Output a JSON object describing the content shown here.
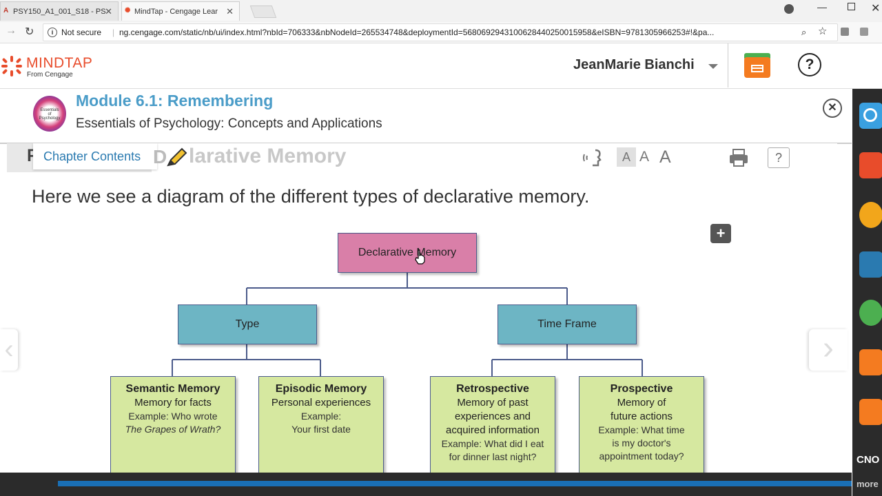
{
  "browser": {
    "tabs": [
      {
        "label": "PSY150_A1_001_S18 - PS",
        "active": false
      },
      {
        "label": "MindTap - Cengage Lear",
        "active": true
      }
    ],
    "not_secure": "Not secure",
    "url": "ng.cengage.com/static/nb/ui/index.html?nbId=706333&nbNodeId=265534748&deploymentId=5680692943100628440250015958&eISBN=9781305966253#!&pa..."
  },
  "mindtap": {
    "logo_text": "MINDTAP",
    "logo_sub": "From Cengage",
    "user_name": "JeanMarie Bianchi",
    "help": "?"
  },
  "module": {
    "title": "Module 6.1: Remembering",
    "subtitle": "Essentials of Psychology: Concepts and Applications",
    "cover_label": "Essentials of Psychology"
  },
  "toolbar": {
    "chapter_contents": "Chapter Contents",
    "heading_faded": "larative Memory",
    "heading_prefix": "F",
    "heading_d": "D",
    "font_sizes": [
      "A",
      "A",
      "A"
    ],
    "help": "?"
  },
  "body": {
    "intro": "Here we see a diagram of the different types of declarative memory."
  },
  "diagram": {
    "root": "Declarative Memory",
    "mid": [
      "Type",
      "Time Frame"
    ],
    "leaves": [
      {
        "title": "Semantic Memory",
        "desc": [
          "Memory for facts"
        ],
        "ex": [
          "Example: Who wrote"
        ],
        "ex_italic": "The Grapes of Wrath?"
      },
      {
        "title": "Episodic Memory",
        "desc": [
          "Personal experiences"
        ],
        "ex": [
          "Example:",
          "Your first date"
        ],
        "ex_italic": ""
      },
      {
        "title": "Retrospective",
        "desc": [
          "Memory of past",
          "experiences and",
          "acquired information"
        ],
        "ex": [
          "Example: What did I eat",
          "for dinner last night?"
        ],
        "ex_italic": ""
      },
      {
        "title": "Prospective",
        "desc": [
          "Memory of",
          "future actions"
        ],
        "ex": [
          "Example: What time",
          "is my doctor's",
          "appointment today?"
        ],
        "ex_italic": ""
      }
    ]
  },
  "sidebar": {
    "bottom_label": "more",
    "cno": "CNO"
  },
  "colors": {
    "root_fill": "#d97fa8",
    "mid_fill": "#6db5c4",
    "leaf_fill": "#d6e8a0",
    "title_blue": "#4a9cc8",
    "progress": "#1a6fb5"
  }
}
